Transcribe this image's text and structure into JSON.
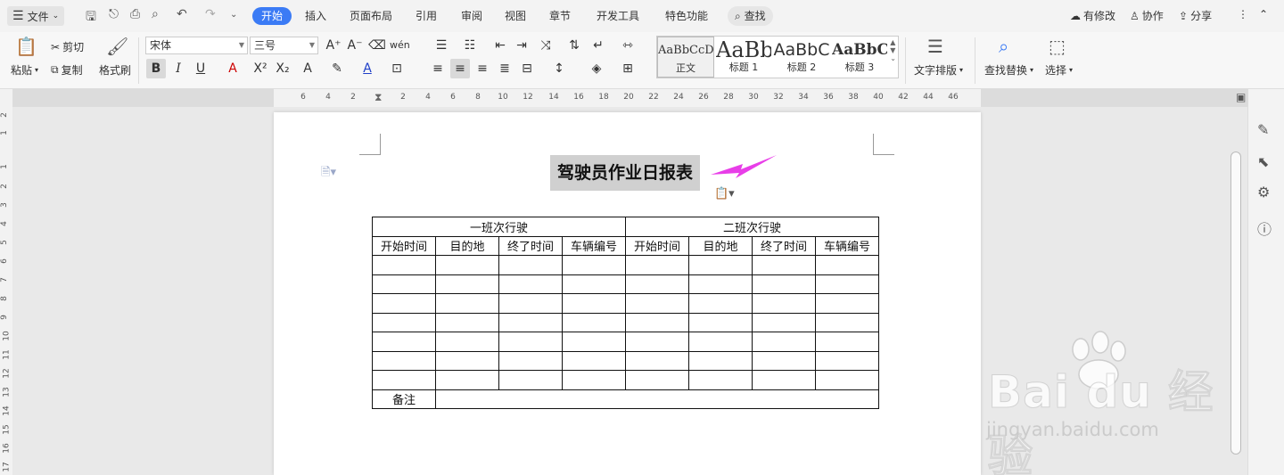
{
  "tabbar": {
    "file_label": "文件",
    "tabs": [
      "开始",
      "插入",
      "页面布局",
      "引用",
      "审阅",
      "视图",
      "章节",
      "开发工具",
      "特色功能"
    ],
    "active_tab": "开始",
    "search_label": "查找",
    "modified_label": "有修改",
    "collab_label": "协作",
    "share_label": "分享"
  },
  "ribbon": {
    "paste": "粘贴",
    "cut": "剪切",
    "copy": "复制",
    "format_painter": "格式刷",
    "font_name": "宋体",
    "font_size": "三号",
    "styles": [
      {
        "preview": "AaBbCcDd",
        "label": "正文"
      },
      {
        "preview": "AaBb",
        "label": "标题 1"
      },
      {
        "preview": "AaBbC",
        "label": "标题 2"
      },
      {
        "preview": "AaBbC",
        "label": "标题 3"
      }
    ],
    "text_layout": "文字排版",
    "find_replace": "查找替换",
    "select": "选择"
  },
  "ruler": {
    "h_ticks": [
      "6",
      "4",
      "2",
      "2",
      "4",
      "6",
      "8",
      "10",
      "12",
      "14",
      "16",
      "18",
      "20",
      "22",
      "24",
      "26",
      "28",
      "30",
      "32",
      "34",
      "36",
      "38",
      "40",
      "42",
      "44",
      "46"
    ],
    "v_ticks": [
      "2",
      "1",
      "1",
      "2",
      "3",
      "4",
      "5",
      "6",
      "7",
      "8",
      "9",
      "10",
      "11",
      "12",
      "13",
      "14",
      "15",
      "16",
      "17"
    ]
  },
  "document": {
    "title": "驾驶员作业日报表",
    "group1": "一班次行驶",
    "group2": "二班次行驶",
    "columns": [
      "开始时间",
      "目的地",
      "终了时间",
      "车辆编号",
      "开始时间",
      "目的地",
      "终了时间",
      "车辆编号"
    ],
    "empty_rows": 7,
    "remark_label": "备注"
  },
  "watermark": {
    "brand": "Bai du 经验",
    "url": "jingyan.baidu.com"
  },
  "colors": {
    "accent": "#3b7bf5",
    "arrow": "#e83ee8"
  }
}
